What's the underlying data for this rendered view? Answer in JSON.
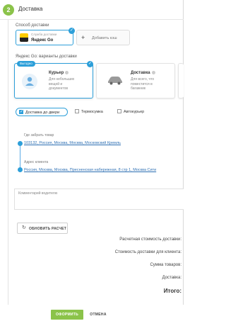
{
  "header": {
    "step_number": "2",
    "title": "Доставка"
  },
  "delivery_method": {
    "label": "Способ доставки",
    "provider": {
      "caption": "Служба доставки",
      "name": "Яндекс Go",
      "selected": true
    },
    "add_button_label": "Добавить кэш"
  },
  "variants": {
    "label": "Яндекс Go: варианты доставки",
    "cards": [
      {
        "badge": "Выгодно",
        "title": "Курьер",
        "description": "Для небольших вещей и документов",
        "selected": true,
        "icon": "courier-icon"
      },
      {
        "title": "Доставка",
        "description": "Для всего, что поместится в багажник",
        "selected": false,
        "icon": "car-icon"
      }
    ]
  },
  "options": [
    {
      "label": "Доставка до двери",
      "checked": true
    },
    {
      "label": "Термосумка",
      "checked": false
    },
    {
      "label": "Автокурьер",
      "checked": false
    }
  ],
  "route": {
    "pickup_label": "Где забрать товар",
    "pickup_address": "103132, Россия, Москва, Москва, Московский Кремль",
    "client_label": "Адрес клиента",
    "client_address": "Россия, Москва, Москва, Пресненская набережная, 8 стр 1, Москва Сити"
  },
  "comment": {
    "label": "Комментарий водителю"
  },
  "recalc_button_label": "ОБНОВИТЬ РАСЧЕТ",
  "summary": {
    "estimated_cost": "Расчетная стоимость доставки:",
    "client_cost": "Стоимость доставки для клиента:",
    "goods_sum": "Сумма товаров:",
    "delivery": "Доставка:",
    "total": "Итого:"
  },
  "footer": {
    "submit_label": "ОФОРМИТЬ",
    "cancel_label": "ОТМЕНА"
  },
  "colors": {
    "accent": "#2d9fd9",
    "green": "#8bc34a"
  }
}
